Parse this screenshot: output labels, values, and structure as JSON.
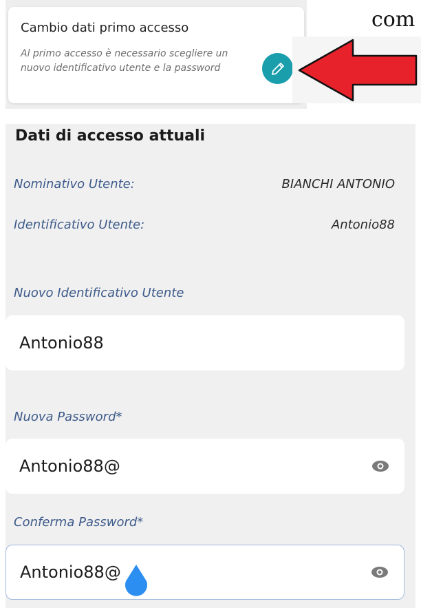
{
  "card": {
    "title": "Cambio dati primo accesso",
    "description": "Al primo accesso è necessario scegliere un nuovo identificativo utente e la password",
    "edit_icon": "pencil-icon"
  },
  "top_right_text": "com",
  "annotation": {
    "icon": "red-arrow-left",
    "color": "#e8222a"
  },
  "section": {
    "title": "Dati di accesso attuali",
    "rows": [
      {
        "label": "Nominativo Utente:",
        "value": "BIANCHI ANTONIO"
      },
      {
        "label": "Identificativo Utente:",
        "value": "Antonio88"
      }
    ]
  },
  "fields": {
    "new_id": {
      "label": "Nuovo Identificativo Utente",
      "value": "Antonio88"
    },
    "new_password": {
      "label": "Nuova Password*",
      "value": "Antonio88@",
      "icon": "eye-icon"
    },
    "confirm_password": {
      "label": "Conferma Password*",
      "value": "Antonio88@",
      "icon": "eye-icon"
    }
  },
  "colors": {
    "accent": "#1a9eac",
    "label": "#3d5a8a",
    "focus_border": "#9fb8e0",
    "cursor": "#2c8ef0"
  }
}
